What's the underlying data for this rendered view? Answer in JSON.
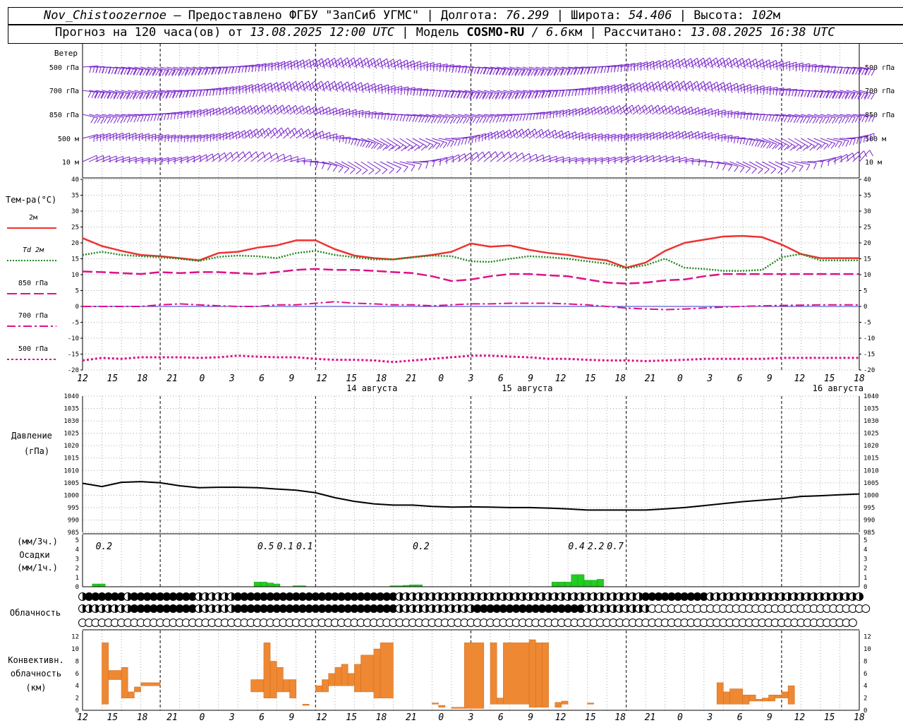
{
  "header": {
    "station": "Nov_Chistoozernoe",
    "provider": " – Предоставлено ФГБУ \"ЗапСиб УГМС\" | Долгота: ",
    "lon": "76.299",
    "lat_label": " | Широта: ",
    "lat": "54.406",
    "alt_label": " | Высота: ",
    "alt": "102",
    "alt_unit": "м",
    "forecast_label": "Прогноз на 120 часа(ов) от ",
    "start_time": "13.08.2025 12:00 UTC",
    "model_label": "  | Модель ",
    "model": "COSMO-RU",
    "resolution": " / 6.6",
    "res_unit": "км",
    "calc_label": " | Рассчитано: ",
    "calc_time": "13.08.2025 16:38 UTC"
  },
  "labels": {
    "wind_title": "Ветер",
    "wind_levels": [
      "500 гПа",
      "700 гПа",
      "850 гПа",
      "500  м",
      "10  м"
    ],
    "temp_title": "Тем-ра(°С)",
    "temp_legend": [
      "2м",
      "Td  2м",
      "850 гПа",
      "700 гПа",
      "500 гПа"
    ],
    "pressure_title": "Давление",
    "pressure_unit": "(гПа)",
    "precip_unit3": "(мм/3ч.)",
    "precip_title": "Осадки",
    "precip_unit1": "(мм/1ч.)",
    "cloud_title": "Облачность",
    "conv_title1": "Конвективн.",
    "conv_title2": "облачность",
    "conv_unit": "(км)"
  },
  "colors": {
    "t2m": "#ee3333",
    "td2m": "#228822",
    "t850": "#dd1188",
    "t700": "#dd1188",
    "t500": "#dd1188",
    "wind": "#7722cc",
    "precip": "#22cc22",
    "conv": "#ee8833",
    "zero_line": "#3333cc"
  },
  "chart_data": [
    {
      "type": "line",
      "title": "Тем-ра(°С)",
      "x": [
        0,
        3,
        6,
        9,
        12,
        15,
        18,
        21,
        24,
        27,
        30,
        33,
        36,
        39,
        42,
        45,
        48,
        51,
        54,
        57,
        60,
        63,
        66,
        69,
        72,
        75,
        78,
        81,
        84,
        87,
        90,
        93,
        96,
        99,
        102,
        105,
        108,
        111,
        114,
        117,
        120
      ],
      "ylim": [
        -20,
        40
      ],
      "series": [
        {
          "name": "2м",
          "values": [
            21.5,
            19,
            17.5,
            16.2,
            15.8,
            15.2,
            14.5,
            16.8,
            17.2,
            18.5,
            19.2,
            20.8,
            20.8,
            18,
            16,
            15.2,
            14.8,
            15.5,
            16.2,
            17.2,
            19.8,
            18.8,
            19.2,
            17.8,
            16.8,
            16.2,
            15.2,
            14.5,
            12.2,
            13.8,
            17.5,
            20,
            21,
            22,
            22.2,
            21.8,
            19.5,
            16.5,
            15.2,
            15.2,
            15.2
          ]
        },
        {
          "name": "Td  2м",
          "values": [
            16.2,
            17.2,
            16.2,
            15.8,
            15.5,
            15,
            14.3,
            15.6,
            16,
            15.8,
            15.2,
            16.8,
            17.5,
            16.2,
            15.5,
            14.8,
            14.8,
            15.5,
            16,
            15.8,
            14.2,
            14,
            15,
            15.8,
            15.5,
            15,
            14.2,
            13.5,
            12,
            13,
            15,
            12.2,
            11.8,
            11.2,
            11.2,
            11.5,
            15.5,
            16.5,
            14.5,
            14.5,
            14.5
          ]
        },
        {
          "name": "850 гПа",
          "values": [
            11,
            10.8,
            10.5,
            10.2,
            10.8,
            10.5,
            10.8,
            10.8,
            10.5,
            10.2,
            10.8,
            11.5,
            11.8,
            11.5,
            11.5,
            11.2,
            10.8,
            10.5,
            9.5,
            8,
            8.5,
            9.5,
            10.2,
            10.2,
            9.8,
            9.5,
            8.5,
            7.5,
            7.2,
            7.5,
            8.2,
            8.5,
            9.5,
            10.2,
            10.2,
            10.2,
            10.2,
            10.2,
            10.2,
            10.2,
            10.2
          ]
        },
        {
          "name": "700 гПа",
          "values": [
            0,
            0,
            0,
            0,
            0.5,
            0.8,
            0.5,
            0.2,
            0,
            0,
            0.5,
            0.5,
            1,
            1.5,
            1,
            0.8,
            0.5,
            0.5,
            0.2,
            0.5,
            0.8,
            0.8,
            1,
            1,
            1,
            0.8,
            0.5,
            0,
            -0.5,
            -0.8,
            -1,
            -0.8,
            -0.5,
            -0.2,
            0,
            0.2,
            0.3,
            0.4,
            0.5,
            0.5,
            0.5
          ]
        },
        {
          "name": "500 гПа",
          "values": [
            -17,
            -16.2,
            -16.5,
            -16,
            -16,
            -16,
            -16.2,
            -16,
            -15.5,
            -15.8,
            -16,
            -16,
            -16.5,
            -16.8,
            -16.8,
            -17,
            -17.5,
            -17,
            -16.5,
            -16,
            -15.5,
            -15.5,
            -15.8,
            -16,
            -16.5,
            -16.5,
            -16.8,
            -17,
            -17,
            -17.2,
            -17,
            -16.8,
            -16.5,
            -16.5,
            -16.5,
            -16.5,
            -16.2,
            -16.2,
            -16.2,
            -16.2,
            -16.2
          ]
        }
      ]
    },
    {
      "type": "line",
      "title": "Давление",
      "ylabel": "(гПа)",
      "x": [
        0,
        3,
        6,
        9,
        12,
        15,
        18,
        21,
        24,
        27,
        30,
        33,
        36,
        39,
        42,
        45,
        48,
        51,
        54,
        57,
        60,
        63,
        66,
        69,
        72,
        75,
        78,
        81,
        84,
        87,
        90,
        93,
        96,
        99,
        102,
        105,
        108,
        111,
        114,
        117,
        120
      ],
      "ylim": [
        985,
        1040
      ],
      "series": [
        {
          "name": "",
          "values": [
            1004.8,
            1003.5,
            1005.2,
            1005.5,
            1005,
            1003.8,
            1003,
            1003.2,
            1003.2,
            1003,
            1002.5,
            1002,
            1001,
            999,
            997.5,
            996.5,
            996,
            996,
            995.5,
            995.2,
            995.3,
            995.2,
            995,
            995,
            994.8,
            994.5,
            994,
            994,
            994,
            994,
            994.5,
            995,
            995.8,
            996.6,
            997.4,
            998,
            998.6,
            999.5,
            999.8,
            1000.2,
            1000.5
          ]
        }
      ]
    },
    {
      "type": "bar",
      "title": "Осадки",
      "ylabel": "(мм/1ч.)",
      "ylim": [
        0,
        5
      ],
      "x": [
        2,
        3,
        27,
        28,
        29,
        30,
        33,
        34,
        48,
        49,
        50,
        51,
        52,
        73,
        74,
        75,
        76,
        77,
        78,
        79,
        80
      ],
      "values": [
        0.3,
        0.3,
        0.5,
        0.5,
        0.4,
        0.3,
        0.1,
        0.1,
        0.1,
        0.1,
        0.15,
        0.2,
        0.2,
        0.5,
        0.5,
        0.5,
        1.3,
        1.3,
        0.7,
        0.7,
        0.8
      ],
      "labels_3h": [
        {
          "x": 2,
          "text": "0.2"
        },
        {
          "x": 27,
          "text": "0.5"
        },
        {
          "x": 30,
          "text": "0.1"
        },
        {
          "x": 33,
          "text": "0.1"
        },
        {
          "x": 51,
          "text": "0.2"
        },
        {
          "x": 75,
          "text": "0.4"
        },
        {
          "x": 78,
          "text": "2.2"
        },
        {
          "x": 81,
          "text": "0.7"
        }
      ]
    },
    {
      "type": "bar",
      "title": "Конвективн. облачность",
      "ylabel": "(км)",
      "ylim": [
        0,
        13
      ],
      "bars": [
        {
          "x0": 3,
          "x1": 4,
          "bottom": 1,
          "top": 11
        },
        {
          "x0": 4,
          "x1": 6,
          "bottom": 5,
          "top": 6.5
        },
        {
          "x0": 6,
          "x1": 7,
          "bottom": 2,
          "top": 7
        },
        {
          "x0": 7,
          "x1": 8,
          "bottom": 2,
          "top": 3
        },
        {
          "x0": 8,
          "x1": 9,
          "bottom": 3,
          "top": 3.8
        },
        {
          "x0": 9,
          "x1": 12,
          "bottom": 4,
          "top": 4.5
        },
        {
          "x0": 26,
          "x1": 28,
          "bottom": 3,
          "top": 5
        },
        {
          "x0": 28,
          "x1": 29,
          "bottom": 2,
          "top": 11
        },
        {
          "x0": 29,
          "x1": 30,
          "bottom": 2,
          "top": 8
        },
        {
          "x0": 30,
          "x1": 31,
          "bottom": 3,
          "top": 7
        },
        {
          "x0": 31,
          "x1": 32,
          "bottom": 3,
          "top": 5
        },
        {
          "x0": 32,
          "x1": 33,
          "bottom": 2,
          "top": 5
        },
        {
          "x0": 34,
          "x1": 35,
          "bottom": 0.8,
          "top": 1
        },
        {
          "x0": 36,
          "x1": 37,
          "bottom": 3,
          "top": 4
        },
        {
          "x0": 37,
          "x1": 38,
          "bottom": 3,
          "top": 5
        },
        {
          "x0": 38,
          "x1": 39,
          "bottom": 4,
          "top": 6
        },
        {
          "x0": 39,
          "x1": 40,
          "bottom": 4,
          "top": 7
        },
        {
          "x0": 40,
          "x1": 41,
          "bottom": 4,
          "top": 7.5
        },
        {
          "x0": 41,
          "x1": 42,
          "bottom": 4,
          "top": 6
        },
        {
          "x0": 42,
          "x1": 43,
          "bottom": 3,
          "top": 7.5
        },
        {
          "x0": 43,
          "x1": 45,
          "bottom": 3,
          "top": 9
        },
        {
          "x0": 45,
          "x1": 46,
          "bottom": 2,
          "top": 10
        },
        {
          "x0": 46,
          "x1": 48,
          "bottom": 2,
          "top": 11
        },
        {
          "x0": 54,
          "x1": 55,
          "bottom": 1,
          "top": 1.2
        },
        {
          "x0": 55,
          "x1": 56,
          "bottom": 0.5,
          "top": 0.8
        },
        {
          "x0": 57,
          "x1": 59,
          "bottom": 0.3,
          "top": 0.5
        },
        {
          "x0": 59,
          "x1": 62,
          "bottom": 0.3,
          "top": 11
        },
        {
          "x0": 63,
          "x1": 64,
          "bottom": 1,
          "top": 11
        },
        {
          "x0": 64,
          "x1": 65,
          "bottom": 1,
          "top": 2
        },
        {
          "x0": 65,
          "x1": 69,
          "bottom": 1,
          "top": 11
        },
        {
          "x0": 69,
          "x1": 70,
          "bottom": 0.5,
          "top": 11.5
        },
        {
          "x0": 70,
          "x1": 71,
          "bottom": 0.5,
          "top": 11
        },
        {
          "x0": 71,
          "x1": 72,
          "bottom": 0.5,
          "top": 11
        },
        {
          "x0": 73,
          "x1": 74,
          "bottom": 0.5,
          "top": 1.3
        },
        {
          "x0": 74,
          "x1": 75,
          "bottom": 1,
          "top": 1.5
        },
        {
          "x0": 78,
          "x1": 79,
          "bottom": 1,
          "top": 1.2
        },
        {
          "x0": 98,
          "x1": 99,
          "bottom": 1,
          "top": 4.5
        },
        {
          "x0": 99,
          "x1": 100,
          "bottom": 1,
          "top": 3
        },
        {
          "x0": 100,
          "x1": 102,
          "bottom": 1,
          "top": 3.5
        },
        {
          "x0": 102,
          "x1": 103,
          "bottom": 1,
          "top": 2.5
        },
        {
          "x0": 103,
          "x1": 104,
          "bottom": 1.5,
          "top": 2.5
        },
        {
          "x0": 104,
          "x1": 105,
          "bottom": 1.5,
          "top": 1.8
        },
        {
          "x0": 105,
          "x1": 106,
          "bottom": 1.5,
          "top": 2
        },
        {
          "x0": 106,
          "x1": 107,
          "bottom": 1.5,
          "top": 2.5
        },
        {
          "x0": 107,
          "x1": 108,
          "bottom": 2,
          "top": 2.5
        },
        {
          "x0": 108,
          "x1": 109,
          "bottom": 2,
          "top": 3
        },
        {
          "x0": 109,
          "x1": 110,
          "bottom": 1,
          "top": 4
        }
      ]
    },
    {
      "type": "table",
      "title": "Облачность",
      "rows": [
        "HFFFFFFHFFFFFFFFFFHHHHHHFFFFFFFFFFFFFFFFFFFFFFFFFHHHHHHHHHHHHHHHHHHHHHHHHHHHHHHHHHHHHHHFFFFFFFFFFHHHHHHHHHHHHHHHHHHHHHHHH",
        "HHHHHHHHFFFFFFFFFFHHHHHHFFFFFFFFFFFFFFFFFFFFFFFFFHHHHHHHHHHHHFFFFFFFFFFFFFFFFFHHHHHHHHHHOOOOOOOOOOOOOOOOOOOOOOOOOOOOOOOOOO",
        "OOOOOOOOOOOOOOOOOOOOOOOOOOOOOOOOOOOOOOOOOOOOOOOOOOOOOOOOOOOOOOOOOOOOOOOOOOOOOOOOOOOOOOOOOOOOOOOOOOOOOOOOOOOOOOOOOOOOOOOO"
      ]
    }
  ],
  "axis": {
    "hours": [
      "12",
      "15",
      "18",
      "21",
      "0",
      "3",
      "6",
      "9",
      "12",
      "15",
      "18",
      "21",
      "0",
      "3",
      "6",
      "9",
      "12",
      "15",
      "18",
      "21",
      "0",
      "3",
      "6",
      "9",
      "12",
      "15",
      "18"
    ],
    "dates": [
      {
        "hour": 24,
        "text": "14 августа"
      },
      {
        "hour": 48,
        "text": "15 августа"
      },
      {
        "hour": 96,
        "text": "16 августа"
      }
    ]
  }
}
